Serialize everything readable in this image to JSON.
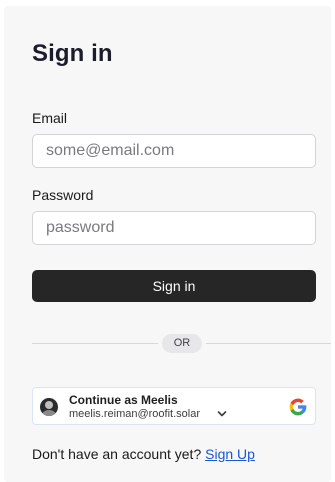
{
  "form": {
    "title": "Sign in",
    "email_label": "Email",
    "email_placeholder": "some@email.com",
    "password_label": "Password",
    "password_placeholder": "password",
    "submit_label": "Sign in"
  },
  "divider": {
    "label": "OR"
  },
  "google": {
    "continue_label": "Continue as Meelis",
    "account_email": "meelis.reiman@roofit.solar",
    "brand_colors": {
      "blue": "#4285F4",
      "red": "#EA4335",
      "yellow": "#FBBC05",
      "green": "#34A853"
    }
  },
  "footer": {
    "prompt": "Don't have an account yet?",
    "signup_label": "Sign Up",
    "link_color": "#1a56db"
  }
}
